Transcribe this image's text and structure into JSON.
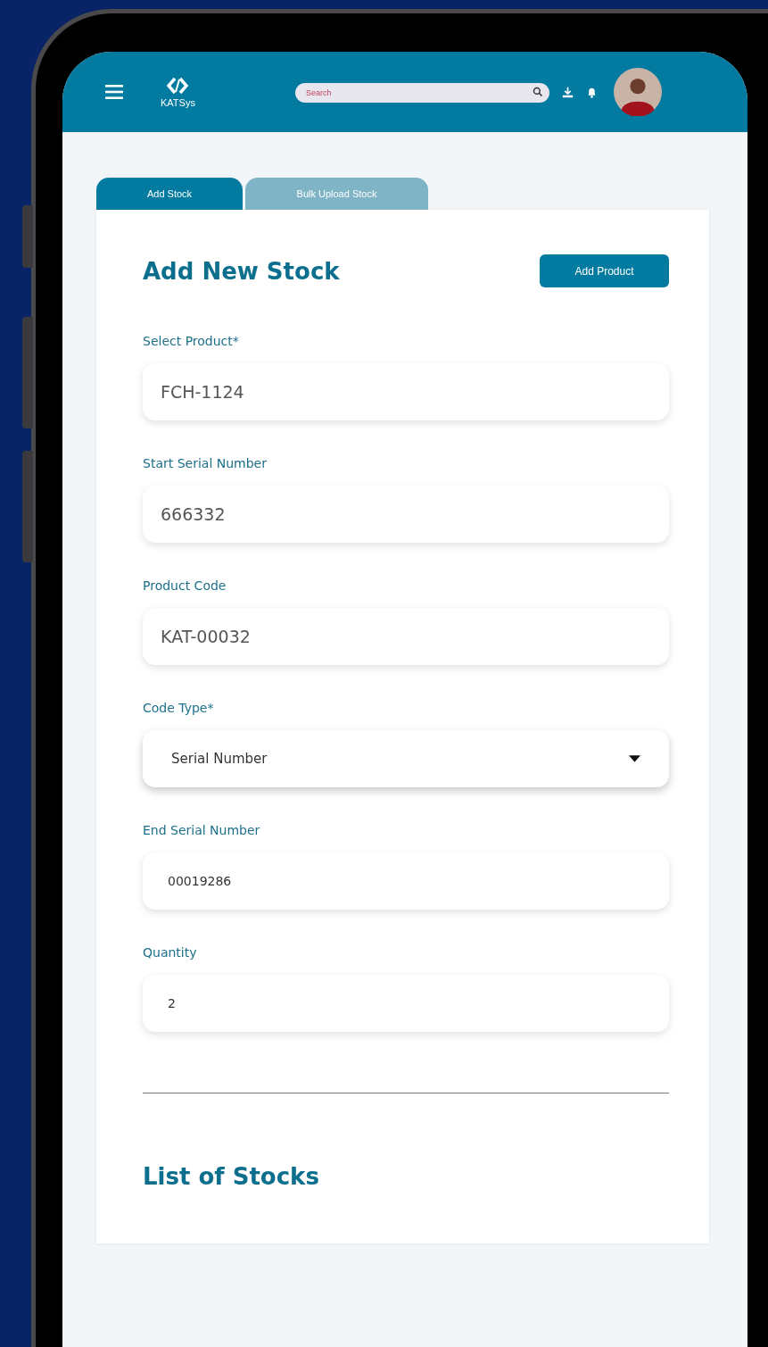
{
  "header": {
    "logo_text": "KATSys",
    "search": {
      "placeholder": "Search"
    }
  },
  "tabs": [
    {
      "label": "Add Stock",
      "selected": true
    },
    {
      "label": "Bulk Upload Stock",
      "selected": false
    }
  ],
  "form": {
    "title": "Add New Stock",
    "action_button": "Add Product",
    "fields": [
      {
        "kind": "text",
        "label": "Select Product*",
        "value": "FCH-1124"
      },
      {
        "kind": "text",
        "label": "Start Serial Number",
        "value": "666332"
      },
      {
        "kind": "text",
        "label": "Product Code",
        "value": "KAT-00032"
      },
      {
        "kind": "select",
        "label": "Code Type*",
        "value": "Serial Number"
      },
      {
        "kind": "entry",
        "label": "End Serial Number",
        "value": "00019286"
      },
      {
        "kind": "entry",
        "label": "Quantity",
        "value": "2"
      }
    ]
  },
  "list": {
    "title": "List of Stocks"
  }
}
